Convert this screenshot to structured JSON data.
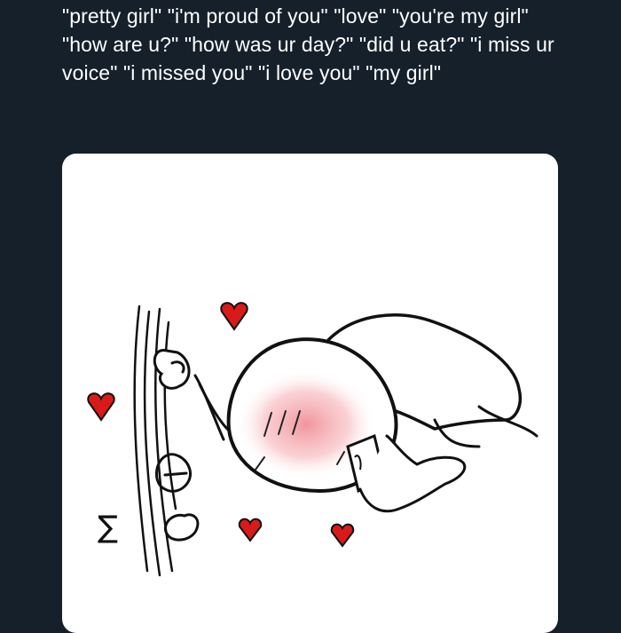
{
  "tweet": {
    "text": "\"pretty girl\" \"i'm proud of you\" \"love\" \"you're my girl\" \"how are u?\" \"how was ur day?\" \"did u eat?\" \"i miss ur voice\" \"i missed you\" \"i love you\" \"my girl\""
  },
  "media": {
    "scribble_text": "∑"
  },
  "colors": {
    "background": "#15202b",
    "text": "#ffffff",
    "card": "#ffffff",
    "heart": "#d91a1a",
    "blush": "#f3a7ad"
  },
  "icons": [
    "heart-icon",
    "phone-icon"
  ]
}
